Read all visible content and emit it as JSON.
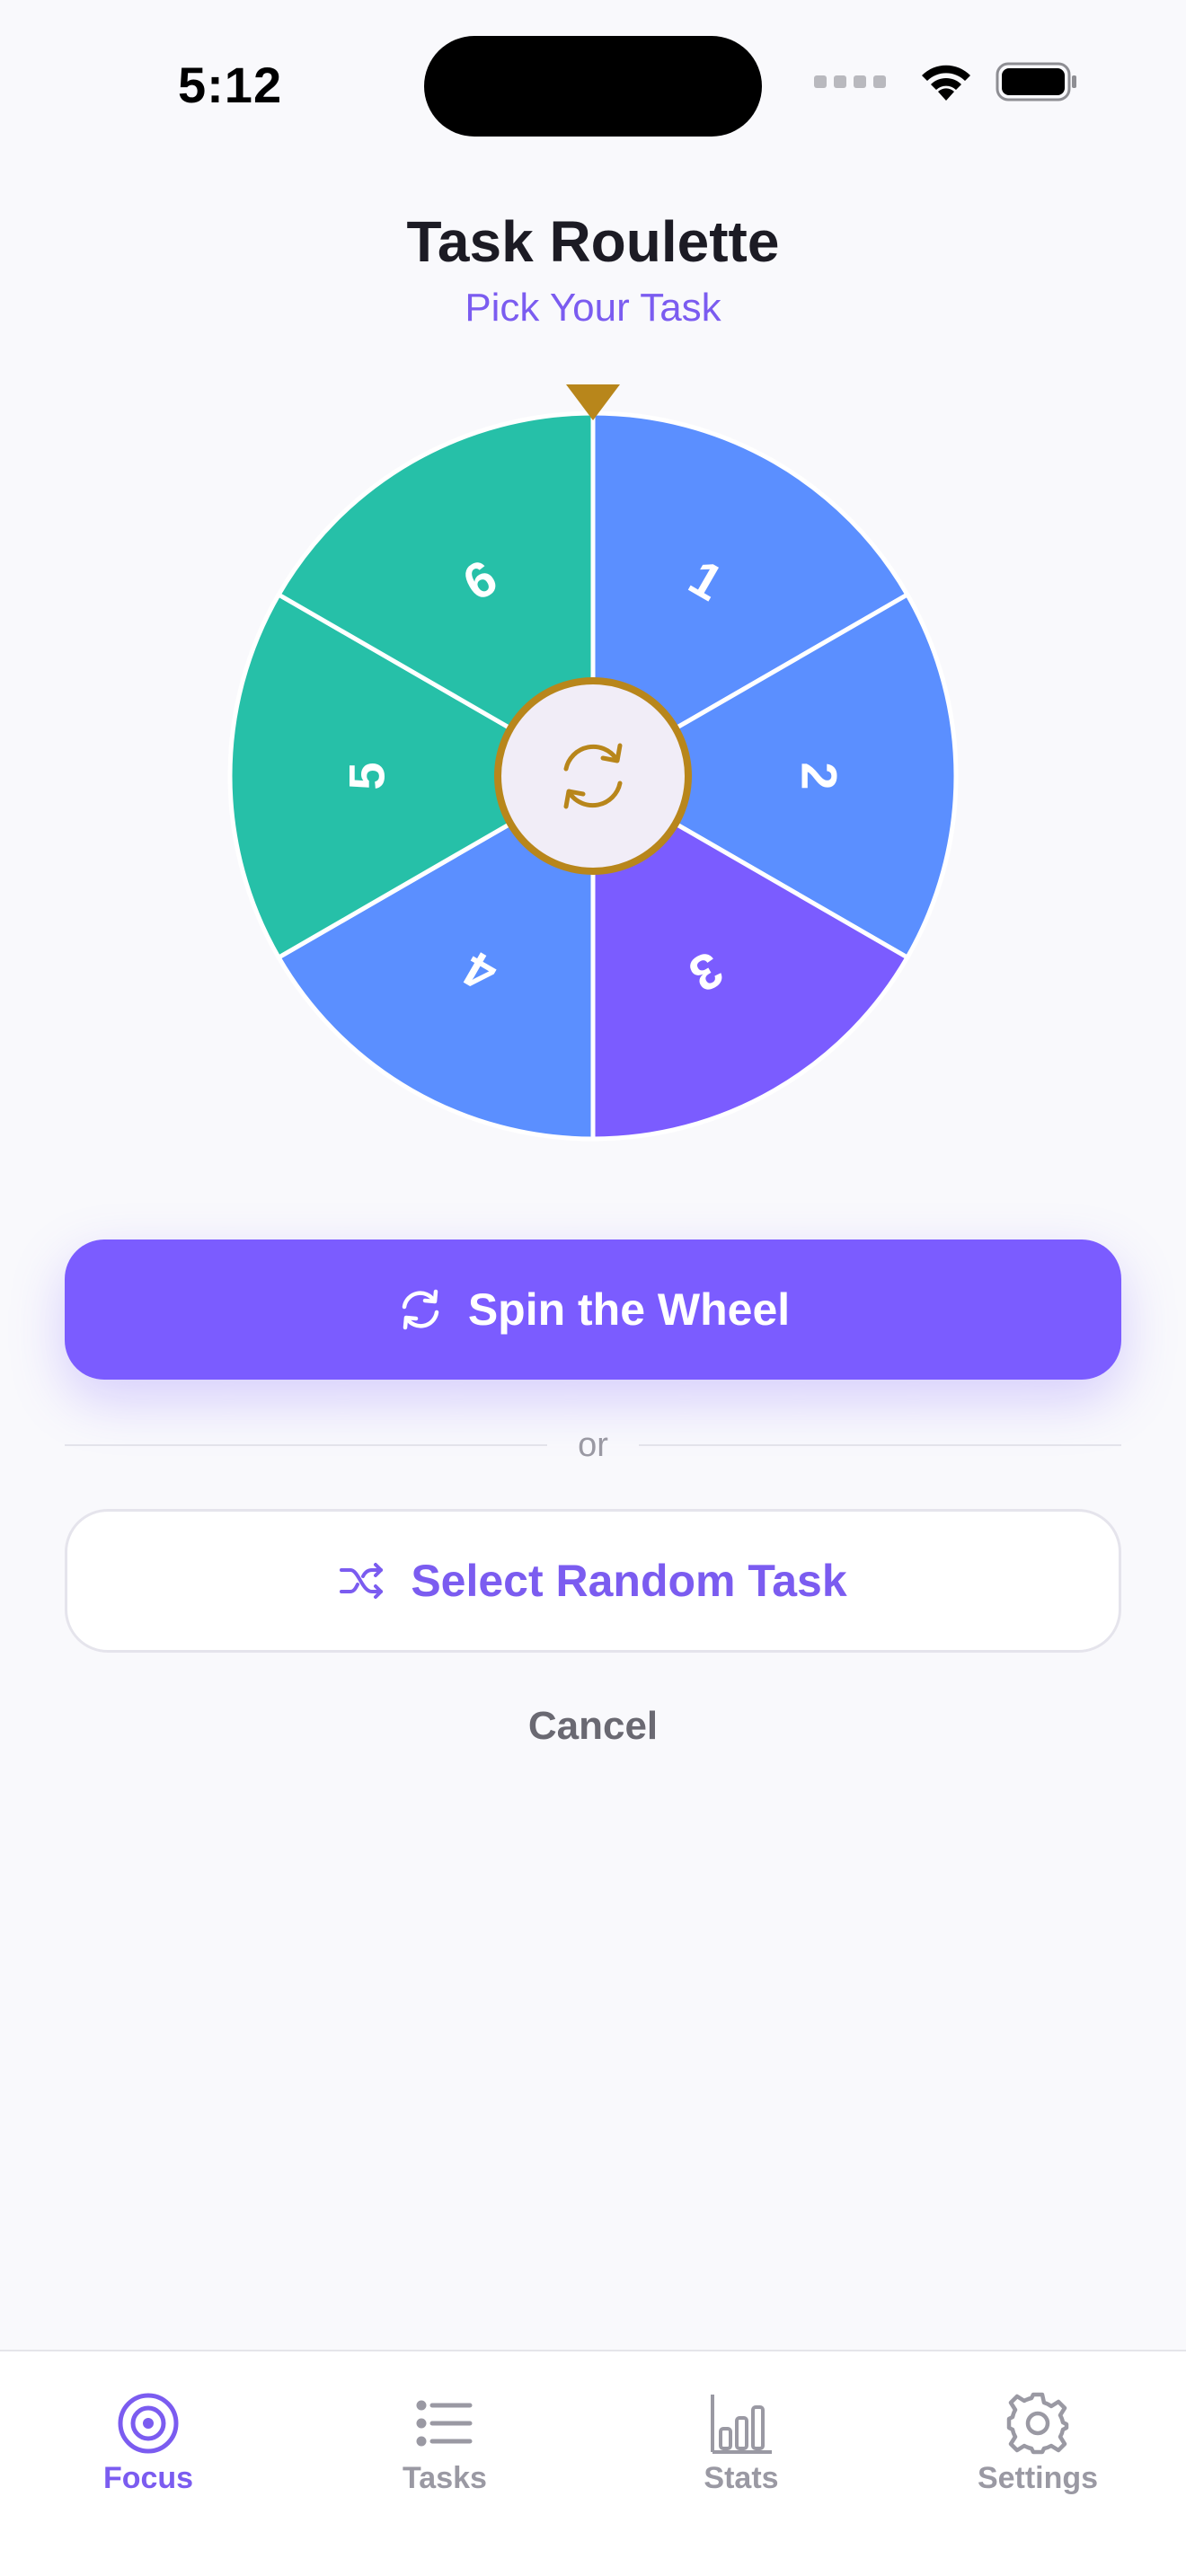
{
  "status_bar": {
    "time": "5:12"
  },
  "header": {
    "title": "Task Roulette",
    "subtitle": "Pick Your Task"
  },
  "wheel": {
    "segments": [
      {
        "label": "1",
        "color": "#5b8fff"
      },
      {
        "label": "2",
        "color": "#5b8fff"
      },
      {
        "label": "3",
        "color": "#7b5cff"
      },
      {
        "label": "4",
        "color": "#5b8fff"
      },
      {
        "label": "5",
        "color": "#26c0a8"
      },
      {
        "label": "6",
        "color": "#26c0a8"
      }
    ],
    "pointer_color": "#b8861b",
    "hub_color": "#f1edf7",
    "hub_ring_color": "#b8861b"
  },
  "actions": {
    "spin_label": "Spin the Wheel",
    "divider_text": "or",
    "random_label": "Select Random Task",
    "cancel_label": "Cancel"
  },
  "tabs": [
    {
      "label": "Focus",
      "icon": "target-icon",
      "active": true
    },
    {
      "label": "Tasks",
      "icon": "list-icon",
      "active": false
    },
    {
      "label": "Stats",
      "icon": "bar-chart-icon",
      "active": false
    },
    {
      "label": "Settings",
      "icon": "gear-icon",
      "active": false
    }
  ],
  "colors": {
    "accent": "#7b5cff",
    "inactive": "#9a99a3",
    "background": "#f9f9fc"
  }
}
